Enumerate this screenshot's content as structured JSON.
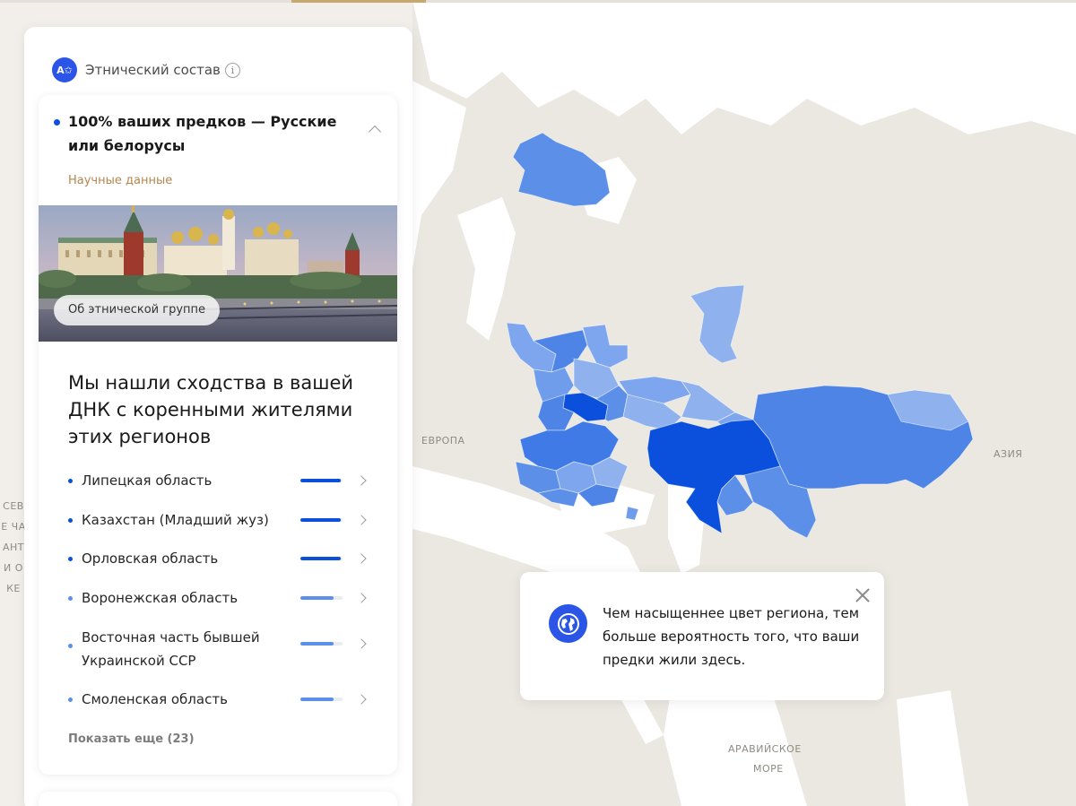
{
  "map": {
    "labels": {
      "europe": "ЕВРОПА",
      "asia": "АЗИЯ",
      "arabian_sea_1": "АРАВИЙСКОЕ",
      "arabian_sea_2": "МОРЕ",
      "ocean_fragment": "СЕВЕ ЧА АНТИ ОКЕ"
    },
    "colors": {
      "strong": "#0b50dc",
      "medium": "#3f7ae6",
      "light": "#6f9dec",
      "pale": "#8fb2ef",
      "land": "#e9e5df",
      "water": "#ffffff"
    }
  },
  "panel": {
    "badge_text": "A✩",
    "title": "Этнический состав",
    "info_icon": "i",
    "card": {
      "title": "100% ваших предков — Русские или белорусы",
      "science_link": "Научные данные",
      "photo_button": "Об этнической группе",
      "match_title": "Мы нашли сходства в вашей ДНК с коренными жителями этих регионов",
      "regions": [
        {
          "name": "Липецкая область",
          "level": 0.95,
          "color": "#0b50dc"
        },
        {
          "name": "Казахстан (Младший жуз)",
          "level": 0.95,
          "color": "#0b50dc"
        },
        {
          "name": "Орловская область",
          "level": 0.95,
          "color": "#0b50dc"
        },
        {
          "name": "Воронежская область",
          "level": 0.78,
          "color": "#5b8fe8"
        },
        {
          "name": "Восточная часть бывшей Украинской ССР",
          "level": 0.78,
          "color": "#5b8fe8"
        },
        {
          "name": "Смоленская область",
          "level": 0.78,
          "color": "#5b8fe8"
        }
      ],
      "show_more": "Показать еще (23)"
    }
  },
  "tooltip": {
    "text": "Чем насыщеннее цвет региона, тем больше вероятность того, что ваши предки жили здесь.",
    "close_icon": "close-icon",
    "globe_icon": "globe-icon"
  }
}
